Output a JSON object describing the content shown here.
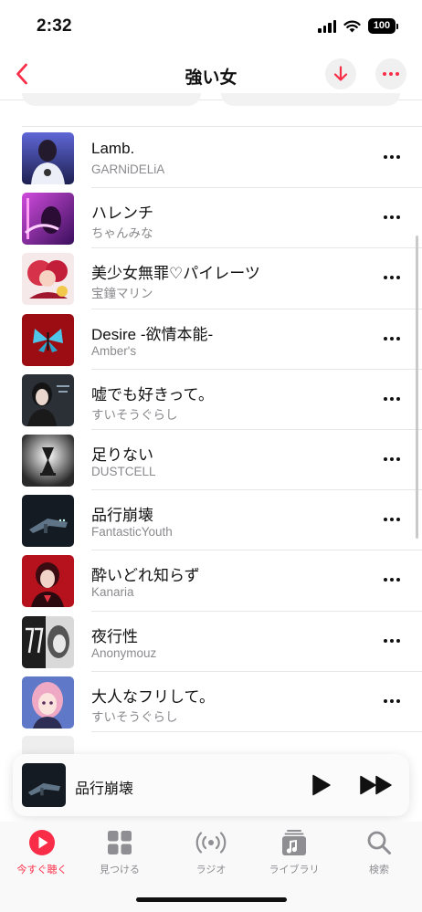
{
  "status_bar": {
    "time": "2:32",
    "battery": "100"
  },
  "nav": {
    "title": "強い女",
    "back_icon": "chevron-left-icon",
    "download_icon": "download-arrow-icon",
    "more_icon": "ellipsis-icon"
  },
  "colors": {
    "accent": "#fa2d48",
    "secondary_text": "#8a8a8e",
    "separator": "#e6e6e6"
  },
  "tracks": [
    {
      "title": "Lamb.",
      "artist": "GARNiDELiA"
    },
    {
      "title": "ハレンチ",
      "artist": "ちゃんみな"
    },
    {
      "title": "美少女無罪♡パイレーツ",
      "artist": "宝鐘マリン"
    },
    {
      "title": "Desire -欲情本能-",
      "artist": "Amber's"
    },
    {
      "title": "嘘でも好きって。",
      "artist": "すいそうぐらし"
    },
    {
      "title": "足りない",
      "artist": "DUSTCELL"
    },
    {
      "title": "品行崩壊",
      "artist": "FantasticYouth"
    },
    {
      "title": "酔いどれ知らず",
      "artist": "Kanaria"
    },
    {
      "title": "夜行性",
      "artist": "Anonymouz"
    },
    {
      "title": "大人なフリして。",
      "artist": "すいそうぐらし"
    }
  ],
  "mini_player": {
    "title": "品行崩壊"
  },
  "tab_bar": [
    {
      "label": "今すぐ聴く",
      "icon": "play-circle-icon",
      "active": true
    },
    {
      "label": "見つける",
      "icon": "grid-icon",
      "active": false
    },
    {
      "label": "ラジオ",
      "icon": "radio-waves-icon",
      "active": false
    },
    {
      "label": "ライブラリ",
      "icon": "music-note-library-icon",
      "active": false
    },
    {
      "label": "検索",
      "icon": "search-icon",
      "active": false
    }
  ]
}
